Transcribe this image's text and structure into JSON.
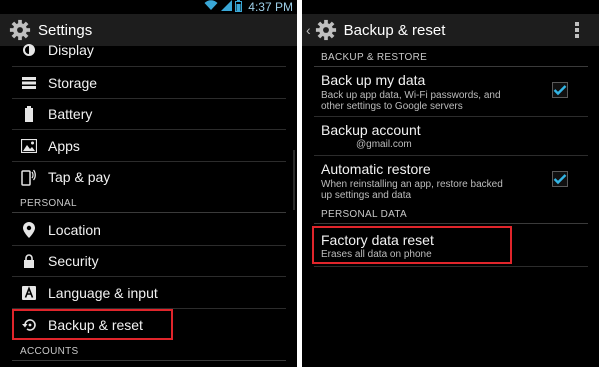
{
  "status_bar": {
    "time": "4:37 PM",
    "icons": [
      "wifi-icon",
      "signal-icon",
      "battery-icon"
    ]
  },
  "left_panel": {
    "title": "Settings",
    "items": [
      {
        "label": "Display",
        "icon": "display-brightness-icon"
      },
      {
        "label": "Storage",
        "icon": "storage-icon"
      },
      {
        "label": "Battery",
        "icon": "battery-icon"
      },
      {
        "label": "Apps",
        "icon": "apps-icon"
      },
      {
        "label": "Tap & pay",
        "icon": "tap-pay-icon"
      }
    ],
    "section_personal": "PERSONAL",
    "personal_items": [
      {
        "label": "Location",
        "icon": "location-icon"
      },
      {
        "label": "Security",
        "icon": "lock-icon"
      },
      {
        "label": "Language & input",
        "icon": "keyboard-icon"
      },
      {
        "label": "Backup & reset",
        "icon": "backup-restore-icon"
      }
    ],
    "section_accounts": "ACCOUNTS"
  },
  "right_panel": {
    "title": "Backup & reset",
    "section_backup": "BACKUP & RESTORE",
    "back_up_title": "Back up my data",
    "back_up_summary_1": "Back up app data, Wi-Fi passwords, and",
    "back_up_summary_2": "other settings to Google servers",
    "back_up_checked": true,
    "backup_account_title": "Backup account",
    "backup_account_value": "@gmail.com",
    "auto_restore_title": "Automatic restore",
    "auto_restore_summary_1": "When reinstalling an app, restore backed",
    "auto_restore_summary_2": "up settings and data",
    "auto_restore_checked": true,
    "section_personal_data": "PERSONAL DATA",
    "factory_reset_title": "Factory data reset",
    "factory_reset_summary": "Erases all data on phone"
  },
  "colors": {
    "highlight_border": "#e0252b",
    "accent": "#33b5e5",
    "background": "#000000",
    "action_bar": "#1d1d1d"
  }
}
